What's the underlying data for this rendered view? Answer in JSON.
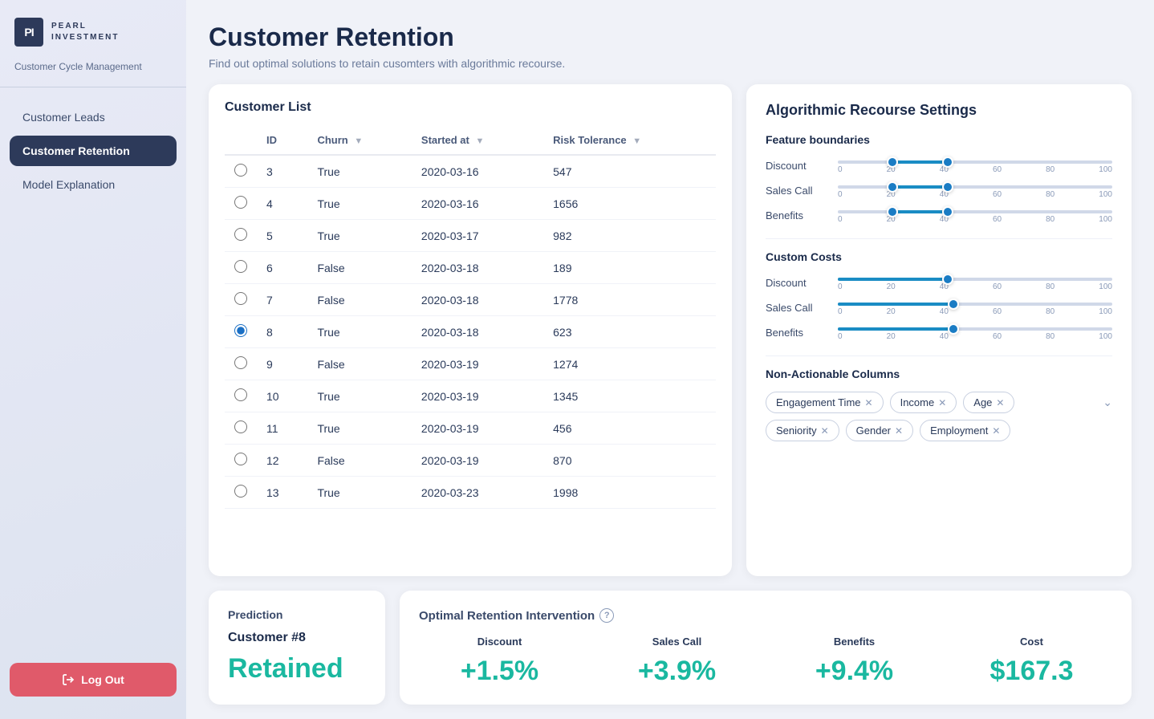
{
  "sidebar": {
    "logo_initials": "PI",
    "logo_line1": "PEARL",
    "logo_line2": "INVESTMENT",
    "subtitle": "Customer Cycle Management",
    "nav_items": [
      {
        "id": "customer-leads",
        "label": "Customer Leads",
        "active": false
      },
      {
        "id": "customer-retention",
        "label": "Customer Retention",
        "active": true
      },
      {
        "id": "model-explanation",
        "label": "Model Explanation",
        "active": false
      }
    ],
    "logout_label": "Log Out"
  },
  "header": {
    "title": "Customer Retention",
    "subtitle": "Find out optimal solutions to retain cusomters with algorithmic recourse."
  },
  "customer_list": {
    "panel_title": "Customer List",
    "columns": [
      "",
      "ID",
      "Churn",
      "Started at",
      "Risk Tolerance"
    ],
    "rows": [
      {
        "id": "3",
        "churn": "True",
        "started_at": "2020-03-16",
        "risk_tolerance": "547",
        "selected": false
      },
      {
        "id": "4",
        "churn": "True",
        "started_at": "2020-03-16",
        "risk_tolerance": "1656",
        "selected": false
      },
      {
        "id": "5",
        "churn": "True",
        "started_at": "2020-03-17",
        "risk_tolerance": "982",
        "selected": false
      },
      {
        "id": "6",
        "churn": "False",
        "started_at": "2020-03-18",
        "risk_tolerance": "189",
        "selected": false
      },
      {
        "id": "7",
        "churn": "False",
        "started_at": "2020-03-18",
        "risk_tolerance": "1778",
        "selected": false
      },
      {
        "id": "8",
        "churn": "True",
        "started_at": "2020-03-18",
        "risk_tolerance": "623",
        "selected": true
      },
      {
        "id": "9",
        "churn": "False",
        "started_at": "2020-03-19",
        "risk_tolerance": "1274",
        "selected": false
      },
      {
        "id": "10",
        "churn": "True",
        "started_at": "2020-03-19",
        "risk_tolerance": "1345",
        "selected": false
      },
      {
        "id": "11",
        "churn": "True",
        "started_at": "2020-03-19",
        "risk_tolerance": "456",
        "selected": false
      },
      {
        "id": "12",
        "churn": "False",
        "started_at": "2020-03-19",
        "risk_tolerance": "870",
        "selected": false
      },
      {
        "id": "13",
        "churn": "True",
        "started_at": "2020-03-23",
        "risk_tolerance": "1998",
        "selected": false
      }
    ]
  },
  "settings": {
    "title": "Algorithmic Recourse Settings",
    "feature_boundaries_label": "Feature boundaries",
    "feature_sliders": [
      {
        "label": "Discount",
        "min": 0,
        "max": 100,
        "low": 20,
        "high": 40
      },
      {
        "label": "Sales Call",
        "min": 0,
        "max": 100,
        "low": 20,
        "high": 40
      },
      {
        "label": "Benefits",
        "min": 0,
        "max": 100,
        "low": 20,
        "high": 40
      }
    ],
    "custom_costs_label": "Custom Costs",
    "cost_sliders": [
      {
        "label": "Discount",
        "min": 0,
        "max": 100,
        "value": 40
      },
      {
        "label": "Sales Call",
        "min": 0,
        "max": 100,
        "value": 42
      },
      {
        "label": "Benefits",
        "min": 0,
        "max": 100,
        "value": 42
      }
    ],
    "non_actionable_label": "Non-Actionable Columns",
    "tags": [
      {
        "label": "Engagement Time"
      },
      {
        "label": "Income"
      },
      {
        "label": "Age"
      },
      {
        "label": "Seniority"
      },
      {
        "label": "Gender"
      },
      {
        "label": "Employment"
      }
    ],
    "slider_ticks": [
      "0",
      "20",
      "40",
      "60",
      "80",
      "100"
    ]
  },
  "prediction": {
    "label": "Prediction",
    "customer_label": "Customer #8",
    "value": "Retained"
  },
  "intervention": {
    "title": "Optimal Retention Intervention",
    "metrics": [
      {
        "header": "Discount",
        "value": "+1.5%"
      },
      {
        "header": "Sales Call",
        "value": "+3.9%"
      },
      {
        "header": "Benefits",
        "value": "+9.4%"
      },
      {
        "header": "Cost",
        "value": "$167.3"
      }
    ]
  }
}
